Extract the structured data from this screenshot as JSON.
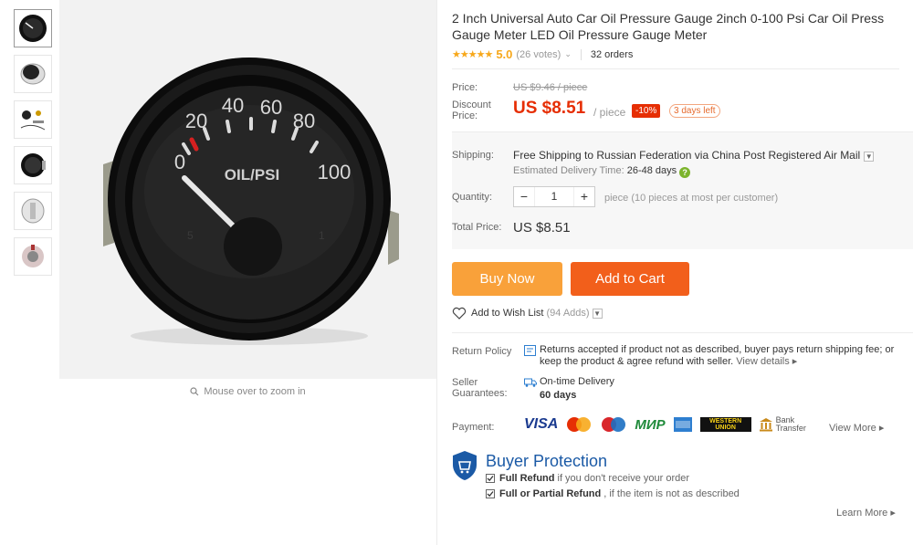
{
  "gallery": {
    "thumbnails": [
      "gauge-front",
      "gauge-side",
      "gauge-kit",
      "gauge-mounted",
      "gauge-back",
      "gauge-sensor"
    ],
    "zoom_hint": "Mouse over to zoom in"
  },
  "gauge": {
    "scale": [
      "0",
      "20",
      "40",
      "60",
      "80",
      "100"
    ],
    "label": "OIL/PSI"
  },
  "product": {
    "title": "2 Inch Universal Auto Car Oil Pressure Gauge 2inch 0-100 Psi Car Oil Press Gauge Meter LED Oil Pressure Gauge Meter",
    "stars": "★★★★★",
    "rating": "5.0",
    "votes": "(26 votes)",
    "orders": "32 orders"
  },
  "price": {
    "price_label": "Price:",
    "original": "US $9.46 / piece",
    "discount_label": "Discount Price:",
    "discount": "US $8.51",
    "per_piece": "/ piece",
    "percent_off": "-10%",
    "days_left": "3 days left"
  },
  "shipping": {
    "label": "Shipping:",
    "text": "Free Shipping to Russian Federation via China Post Registered Air Mail",
    "eta_label": "Estimated Delivery Time:",
    "eta_value": "26-48 days"
  },
  "quantity": {
    "label": "Quantity:",
    "minus": "−",
    "value": "1",
    "plus": "+",
    "note": "piece (10 pieces at most per customer)"
  },
  "total": {
    "label": "Total Price:",
    "value": "US $8.51"
  },
  "actions": {
    "buy_now": "Buy Now",
    "add_to_cart": "Add to Cart",
    "wish_list": "Add to Wish List",
    "wish_count": "(94 Adds)"
  },
  "return_policy": {
    "label": "Return Policy",
    "text": "Returns accepted if product not as described, buyer pays return shipping fee; or keep the product & agree refund with seller.",
    "details": "View details"
  },
  "seller_guarantees": {
    "label": "Seller Guarantees:",
    "title": "On-time Delivery",
    "days": "60 days"
  },
  "payment": {
    "label": "Payment:",
    "visa": "VISA",
    "mir": "МИР",
    "western_union_1": "WESTERN",
    "western_union_2": "UNION",
    "bank_1": "Bank",
    "bank_2": "Transfer",
    "view_more": "View More"
  },
  "buyer_protection": {
    "title": "Buyer Protection",
    "row1_bold": "Full Refund",
    "row1_text": "if you don't receive your order",
    "row2_bold": "Full or Partial Refund",
    "row2_text": ", if the item is not as described",
    "learn_more": "Learn More"
  },
  "colors": {
    "price_red": "#e62e04",
    "buy_now": "#f9a13a",
    "add_to_cart": "#f25f1b",
    "protection_blue": "#1b5aa6",
    "star": "#f7a81b"
  }
}
